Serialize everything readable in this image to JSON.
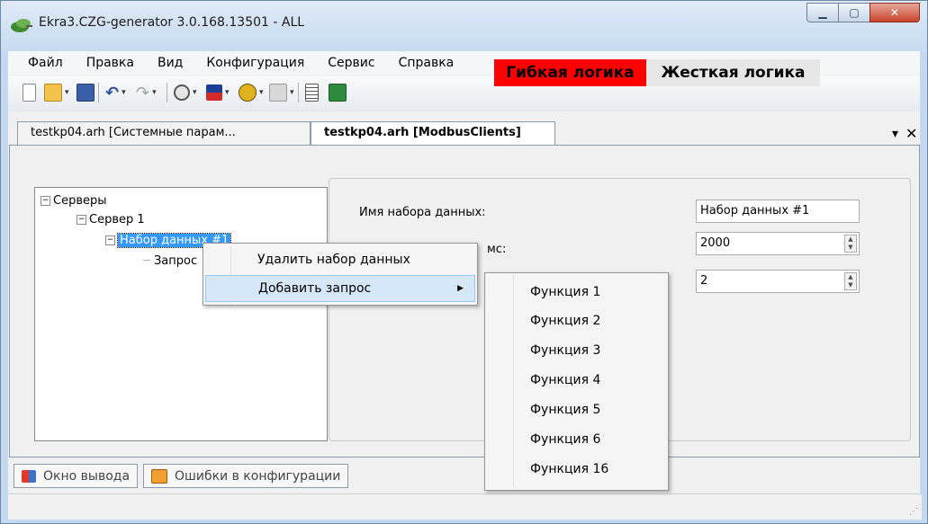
{
  "window": {
    "title": "Ekra3.CZG-generator 3.0.168.13501 - ALL",
    "icon": "app-leaf-icon",
    "controls": {
      "minimize": "minimize-icon",
      "maximize": "maximize-icon",
      "close": "close-icon"
    }
  },
  "menubar": {
    "items": [
      "Файл",
      "Правка",
      "Вид",
      "Конфигурация",
      "Сервис",
      "Справка"
    ]
  },
  "toolbar": {
    "icons": [
      "new-file-icon",
      "open-folder-icon",
      "save-icon",
      "undo-icon",
      "redo-icon",
      "timer-icon",
      "flag-icon",
      "bug-icon",
      "script-icon",
      "list-icon",
      "excel-icon"
    ],
    "flex_logic": "Гибкая логика",
    "hard_logic": "Жесткая логика",
    "colors": {
      "flex_logic_bg": "#ff0000",
      "hard_logic_bg": "#e6e6e6"
    }
  },
  "doc_tabs": [
    {
      "label": "testkp04.arh [Системные парам..."
    },
    {
      "label": "testkp04.arh [ModbusClients]"
    }
  ],
  "tree": {
    "servers": "Серверы",
    "server1": "Сервер 1",
    "dataset": "Набор данных #1",
    "request": "Запрос"
  },
  "properties": {
    "dataset_name_label": "Имя набора данных:",
    "dataset_name_value": "Набор данных #1",
    "period_label_suffix": "мс:",
    "period_value": "2000",
    "third_value": "2"
  },
  "context_menu": {
    "items": [
      "Удалить набор данных",
      "Добавить запрос"
    ],
    "submenu": [
      "Функция 1",
      "Функция 2",
      "Функция 3",
      "Функция 4",
      "Функция 5",
      "Функция 6",
      "Функция 16"
    ]
  },
  "bottom_tabs": [
    "Окно вывода",
    "Ошибки в конфигурации"
  ]
}
